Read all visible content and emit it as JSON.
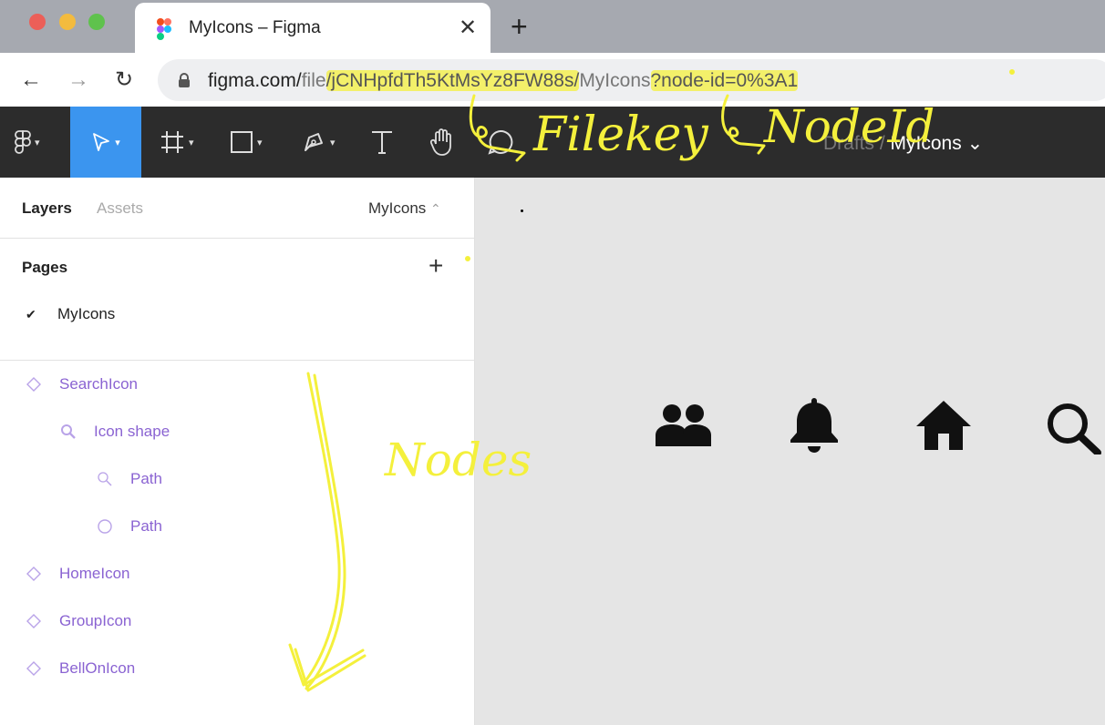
{
  "browser": {
    "tab": {
      "title": "MyIcons – Figma",
      "close": "✕"
    },
    "new_tab": "+",
    "nav": {
      "back": "←",
      "forward": "→",
      "reload": "↻"
    },
    "url": {
      "domain": "figma.com/",
      "path1": "file",
      "file_key": "/jCNHpfdTh5KtMsYz8FW88s/",
      "name": "MyIcons",
      "query": "?node-id=0%3A1"
    }
  },
  "toolbar": {
    "tools": [
      "main-menu",
      "move",
      "frame",
      "shape",
      "pen",
      "text",
      "hand",
      "comment"
    ],
    "breadcrumb": {
      "drafts": "Drafts",
      "sep": "/",
      "file": "MyIcons",
      "chev": "⌄"
    }
  },
  "panel": {
    "tabs": {
      "layers": "Layers",
      "assets": "Assets"
    },
    "page_selector": {
      "label": "MyIcons",
      "chev": "⌃"
    },
    "pages": {
      "title": "Pages",
      "add": "+",
      "check": "✔",
      "items": [
        "MyIcons"
      ]
    },
    "layers": [
      {
        "name": "SearchIcon",
        "icon": "component-icon"
      },
      {
        "name": "Icon shape",
        "icon": "search-icon"
      },
      {
        "name": "Path",
        "icon": "search-icon"
      },
      {
        "name": "Path",
        "icon": "circle-icon"
      },
      {
        "name": "HomeIcon",
        "icon": "component-icon"
      },
      {
        "name": "GroupIcon",
        "icon": "component-icon"
      },
      {
        "name": "BellOnIcon",
        "icon": "component-icon"
      }
    ]
  },
  "canvas": {
    "icons": [
      "group-icon",
      "bell-icon",
      "home-icon",
      "search-icon"
    ]
  },
  "annotations": {
    "filekey": "Filekey",
    "nodeid": "NodeId",
    "nodes": "Nodes"
  },
  "colors": {
    "accent": "#3b95ef",
    "layer": "#8a63d2",
    "highlight": "#f3f06a",
    "toolbar": "#2c2c2c"
  }
}
